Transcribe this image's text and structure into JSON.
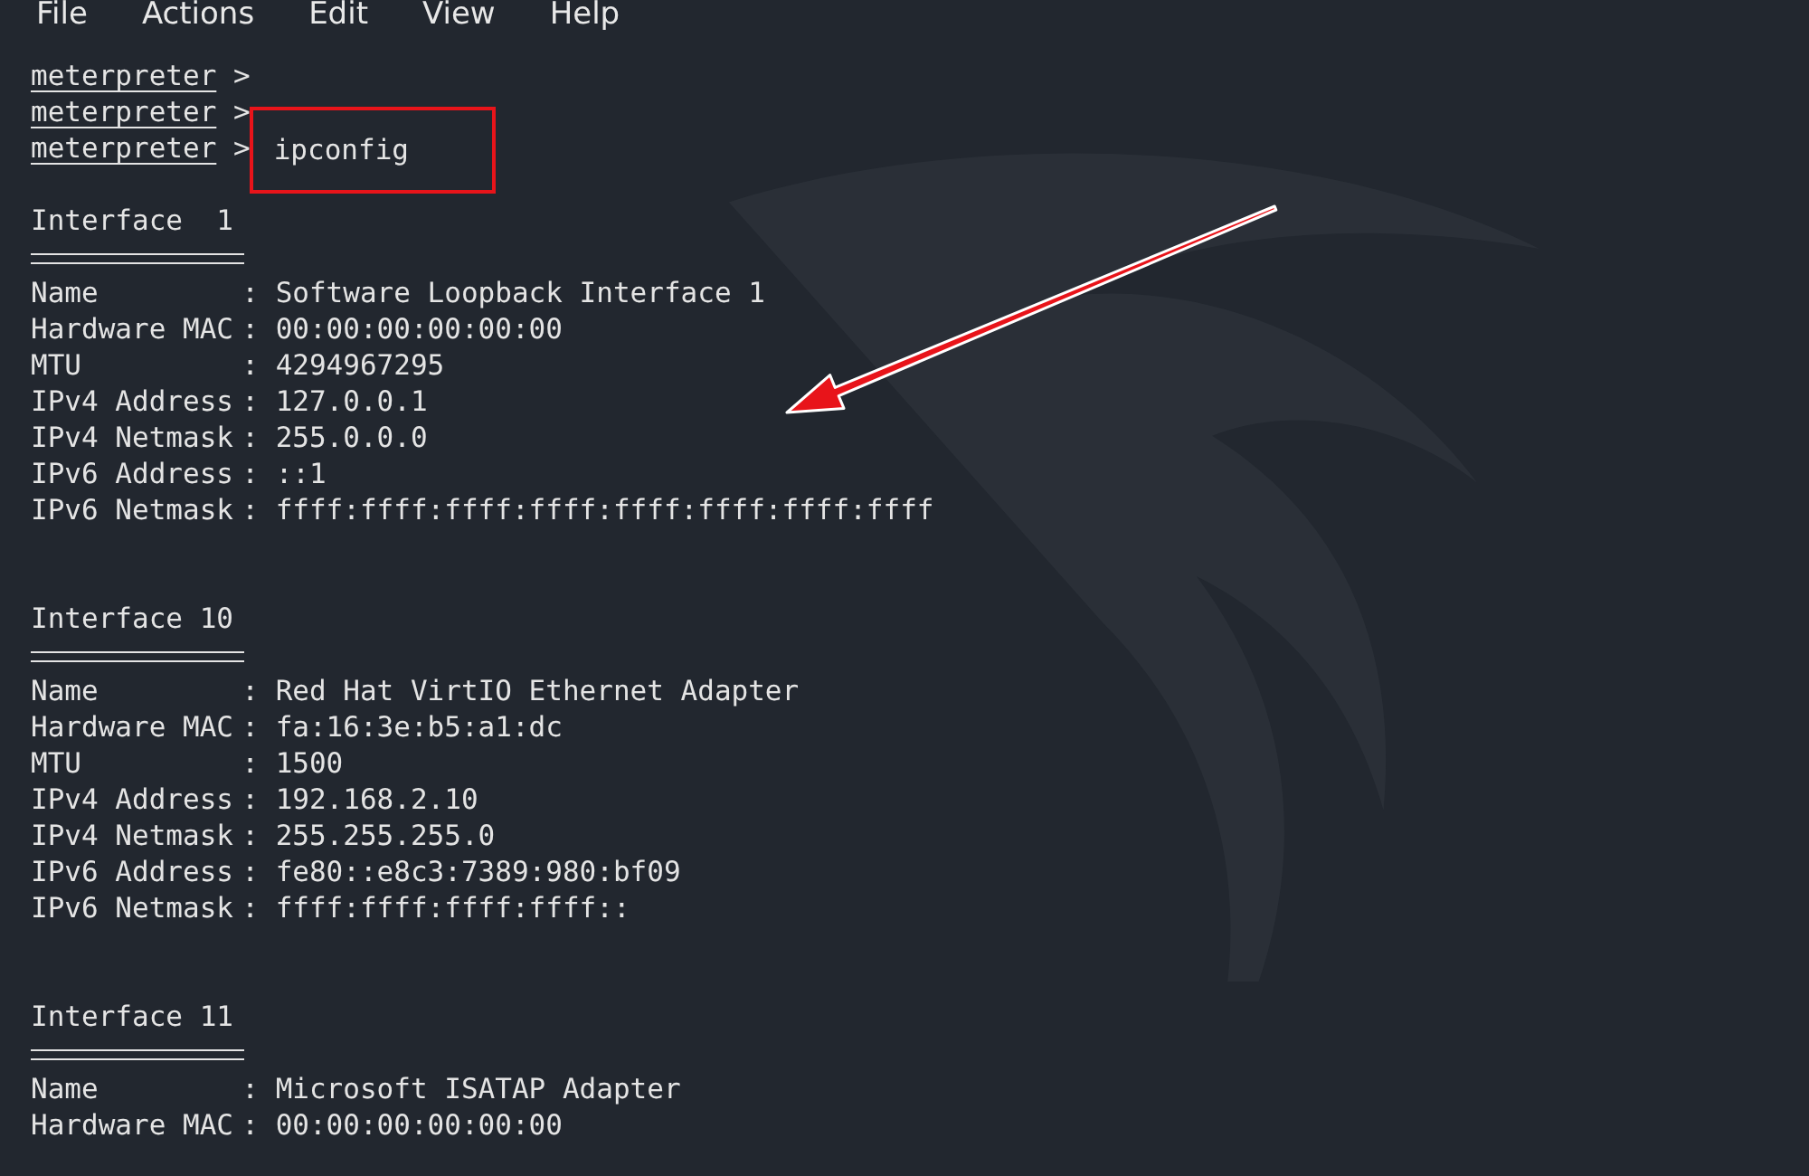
{
  "menu": [
    "File",
    "Actions",
    "Edit",
    "View",
    "Help"
  ],
  "prompts": [
    {
      "prompt": "meterpreter",
      "symbol": ">"
    },
    {
      "prompt": "meterpreter",
      "symbol": ">"
    },
    {
      "prompt": "meterpreter",
      "symbol": ">",
      "command": "ipconfig",
      "highlighted": true
    }
  ],
  "interfaces": [
    {
      "title": "Interface  1",
      "fields": [
        {
          "label": "Name",
          "sep": ":",
          "value": "Software Loopback Interface 1"
        },
        {
          "label": "Hardware MAC",
          "sep": ":",
          "value": "00:00:00:00:00:00"
        },
        {
          "label": "MTU",
          "sep": ":",
          "value": "4294967295"
        },
        {
          "label": "IPv4 Address",
          "sep": ":",
          "value": "127.0.0.1"
        },
        {
          "label": "IPv4 Netmask",
          "sep": ":",
          "value": "255.0.0.0"
        },
        {
          "label": "IPv6 Address",
          "sep": ":",
          "value": "::1"
        },
        {
          "label": "IPv6 Netmask",
          "sep": ":",
          "value": "ffff:ffff:ffff:ffff:ffff:ffff:ffff:ffff"
        }
      ]
    },
    {
      "title": "Interface 10",
      "fields": [
        {
          "label": "Name",
          "sep": ":",
          "value": "Red Hat VirtIO Ethernet Adapter"
        },
        {
          "label": "Hardware MAC",
          "sep": ":",
          "value": "fa:16:3e:b5:a1:dc"
        },
        {
          "label": "MTU",
          "sep": ":",
          "value": "1500"
        },
        {
          "label": "IPv4 Address",
          "sep": ":",
          "value": "192.168.2.10"
        },
        {
          "label": "IPv4 Netmask",
          "sep": ":",
          "value": "255.255.255.0"
        },
        {
          "label": "IPv6 Address",
          "sep": ":",
          "value": "fe80::e8c3:7389:980:bf09"
        },
        {
          "label": "IPv6 Netmask",
          "sep": ":",
          "value": "ffff:ffff:ffff:ffff::"
        }
      ]
    },
    {
      "title": "Interface 11",
      "fields": [
        {
          "label": "Name",
          "sep": ":",
          "value": "Microsoft ISATAP Adapter"
        },
        {
          "label": "Hardware MAC",
          "sep": ":",
          "value": "00:00:00:00:00:00"
        }
      ]
    }
  ]
}
